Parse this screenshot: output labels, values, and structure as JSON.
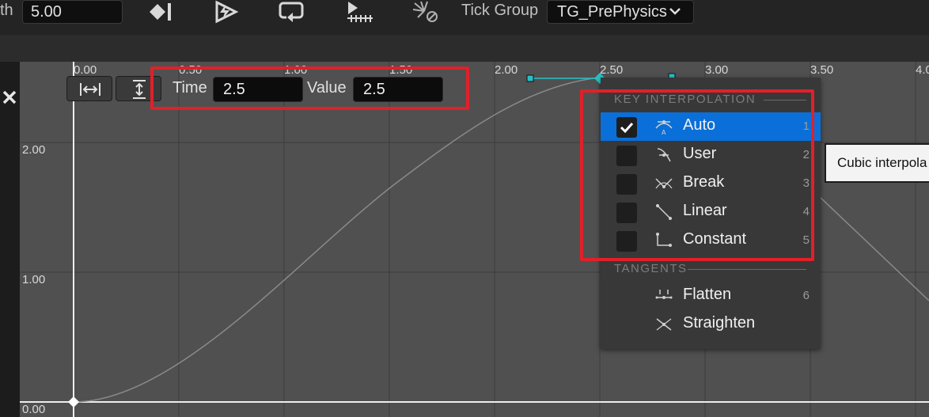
{
  "toolbar": {
    "length_label_partial": "th",
    "length_value": "5.00",
    "tick_group_label": "Tick Group",
    "tick_group_value": "TG_PrePhysics",
    "icons": [
      "add-key-icon",
      "event-icon",
      "loop-icon",
      "timeline-ruler-icon",
      "broadcast-toggle-icon"
    ]
  },
  "graph": {
    "x_ticks": [
      "0.00",
      "0.50",
      "1.00",
      "1.50",
      "2.00",
      "2.50",
      "3.00",
      "3.50",
      "4.0"
    ],
    "y_ticks": [
      "2.00",
      "1.00",
      "0.00"
    ],
    "curve_color": "#8a8a8a",
    "selected_key_color": "#27c0c8"
  },
  "key_editor": {
    "fit_horizontal_icon": "fit-horizontal-icon",
    "fit_vertical_icon": "fit-vertical-icon",
    "time_label": "Time",
    "time_value": "2.5",
    "value_label": "Value",
    "value_value": "2.5"
  },
  "context_menu": {
    "section_interpolation": "KEY INTERPOLATION",
    "section_tangents": "TANGENTS",
    "interpolation_items": [
      {
        "label": "Auto",
        "shortcut": "1",
        "checked": true
      },
      {
        "label": "User",
        "shortcut": "2",
        "checked": false
      },
      {
        "label": "Break",
        "shortcut": "3",
        "checked": false
      },
      {
        "label": "Linear",
        "shortcut": "4",
        "checked": false
      },
      {
        "label": "Constant",
        "shortcut": "5",
        "checked": false
      }
    ],
    "tangent_items": [
      {
        "label": "Flatten",
        "shortcut": "6"
      },
      {
        "label": "Straighten",
        "shortcut": ""
      }
    ],
    "highlight_color": "#0a6fd8"
  },
  "tooltip": {
    "text": "Cubic interpola"
  },
  "annotation_color": "#e0202a"
}
